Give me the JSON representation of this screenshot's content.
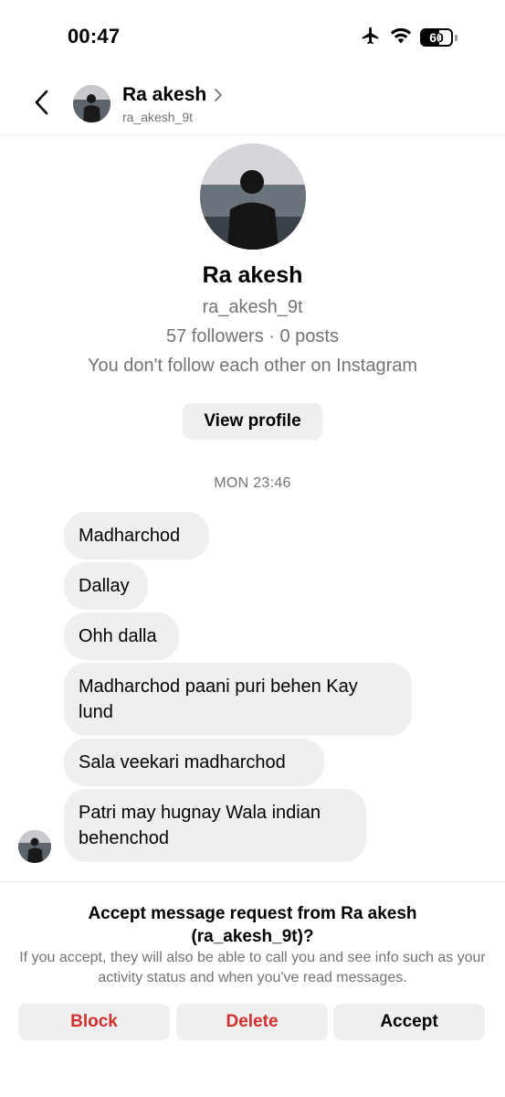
{
  "status_bar": {
    "time": "00:47",
    "battery": "60"
  },
  "header": {
    "name": "Ra akesh",
    "username": "ra_akesh_9t"
  },
  "profile": {
    "name": "Ra akesh",
    "username": "ra_akesh_9t",
    "stats": "57 followers · 0 posts",
    "relationship": "You don't follow each other on Instagram",
    "view_profile_label": "View profile"
  },
  "thread": {
    "timestamp": "MON 23:46",
    "messages": [
      "Madharchod",
      "Dallay",
      "Ohh dalla",
      "Madharchod paani puri behen Kay lund",
      "Sala veekari madharchod",
      "Patri may hugnay Wala indian behenchod"
    ]
  },
  "request": {
    "title": "Accept message request from Ra akesh (ra_akesh_9t)?",
    "description": "If you accept, they will also be able to call you and see info such as your activity status and when you've read messages.",
    "block_label": "Block",
    "delete_label": "Delete",
    "accept_label": "Accept"
  },
  "icons": [
    "back-arrow-icon",
    "chevron-right-icon",
    "airplane-icon",
    "wifi-icon",
    "battery-icon"
  ],
  "colors": {
    "destructive": "#d32f2f",
    "bubble": "#efefef",
    "secondary_text": "#737373"
  }
}
